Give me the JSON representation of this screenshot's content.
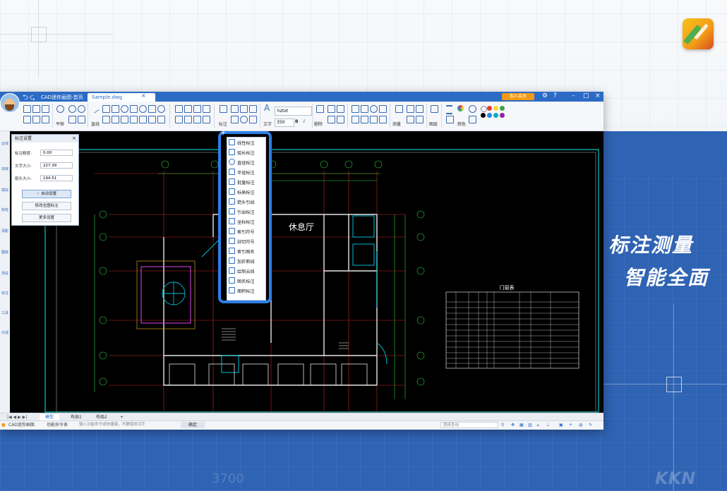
{
  "promo": {
    "slogan_line1": "标注测量",
    "slogan_line2": "智能全面",
    "watermark": "KKN",
    "faint_number": "3700",
    "colors": {
      "background_blue": "#2f63b3",
      "accent_blue": "#2f7fe6"
    }
  },
  "window": {
    "tabs": [
      {
        "label": "CAD迷你画图-首页"
      },
      {
        "label": "Sample.dwg"
      }
    ],
    "vip_label": "加入会员",
    "window_controls": [
      "settings-icon",
      "help-icon",
      "minimize-icon",
      "restore-icon",
      "close-icon"
    ]
  },
  "ribbon": {
    "labels": {
      "pan": "平移",
      "line": "直线",
      "dimension": "标注",
      "text": "文字",
      "delete": "删除",
      "measure": "测量",
      "layer": "图层",
      "color": "颜色"
    },
    "font_value": "hztxt",
    "size_value": "350",
    "bold_label": "B",
    "italic_label": "I",
    "swatch_colors": [
      "#ffffff",
      "#e53935",
      "#fdd835",
      "#43a047",
      "#1e88e5",
      "#00acc1",
      "#8e24aa",
      "#000000"
    ]
  },
  "left_toolbar": [
    "云线",
    "块库",
    "填充",
    "标柱",
    "测距",
    "图库",
    "测试",
    "标注",
    "工具",
    "对话"
  ],
  "dim_panel": {
    "title": "标注设置",
    "rows": [
      {
        "label": "标注精度:",
        "value": "0.00"
      },
      {
        "label": "文字大小:",
        "value": "227.39"
      },
      {
        "label": "箭头大小:",
        "value": "194.51"
      }
    ],
    "auto_label": "自动设置",
    "update_label": "修改全图标注",
    "more_label": "更多设置"
  },
  "dim_menu": {
    "items": [
      "线性标注",
      "弧长标注",
      "直径标注",
      "半径标注",
      "批量标注",
      "标高标注",
      "箭头引线",
      "引出标注",
      "坐标标注",
      "索引符号",
      "剖切符号",
      "索引图名",
      "加折断线",
      "绘制云线",
      "图名标注",
      "面积标注"
    ]
  },
  "drawing": {
    "room_label": "休息厅",
    "table_title": "门窗表"
  },
  "layout_tabs": [
    "模型",
    "布局1",
    "布局2"
  ],
  "statusbar": {
    "app_name": "CAD迷你画图",
    "cmd_label": "功能命令表",
    "cmd_placeholder": "输入功能命令或快捷键，不要使用汉字",
    "confirm_label": "确定",
    "search_placeholder": "图纸查询"
  }
}
